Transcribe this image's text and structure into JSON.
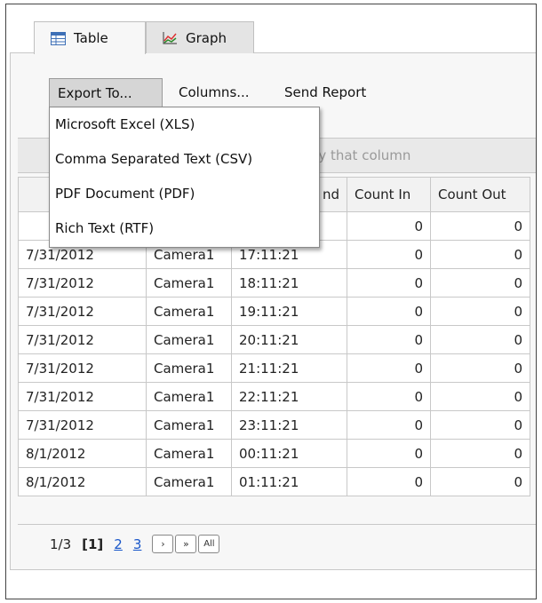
{
  "tabs": [
    {
      "label": "Table",
      "icon": "table-icon",
      "active": true
    },
    {
      "label": "Graph",
      "icon": "line-chart-icon",
      "active": false
    }
  ],
  "toolbar": {
    "export_label": "Export To...",
    "columns_label": "Columns...",
    "send_label": "Send Report"
  },
  "export_menu": {
    "items": [
      "Microsoft Excel (XLS)",
      "Comma Separated Text (CSV)",
      "PDF Document (PDF)",
      "Rich Text (RTF)"
    ]
  },
  "group_bar": {
    "visible_text": "up by that column"
  },
  "table": {
    "visible_headers": [
      "",
      "",
      "nd",
      "Count In",
      "Count Out"
    ],
    "rows": [
      [
        "",
        "",
        "",
        "0",
        "0"
      ],
      [
        "7/31/2012",
        "Camera1",
        "17:11:21",
        "0",
        "0"
      ],
      [
        "7/31/2012",
        "Camera1",
        "18:11:21",
        "0",
        "0"
      ],
      [
        "7/31/2012",
        "Camera1",
        "19:11:21",
        "0",
        "0"
      ],
      [
        "7/31/2012",
        "Camera1",
        "20:11:21",
        "0",
        "0"
      ],
      [
        "7/31/2012",
        "Camera1",
        "21:11:21",
        "0",
        "0"
      ],
      [
        "7/31/2012",
        "Camera1",
        "22:11:21",
        "0",
        "0"
      ],
      [
        "7/31/2012",
        "Camera1",
        "23:11:21",
        "0",
        "0"
      ],
      [
        "8/1/2012",
        "Camera1",
        "00:11:21",
        "0",
        "0"
      ],
      [
        "8/1/2012",
        "Camera1",
        "01:11:21",
        "0",
        "0"
      ]
    ]
  },
  "pager": {
    "page_info": "1/3",
    "current_page": "[1]",
    "pages": [
      "2",
      "3"
    ],
    "next_label": "›",
    "last_label": "»",
    "all_label": "All"
  },
  "colors": {
    "panel_bg": "#f7f7f7",
    "border": "#c8c8c8",
    "link": "#1a57c9",
    "export_btn_bg": "#d6d6d6"
  }
}
